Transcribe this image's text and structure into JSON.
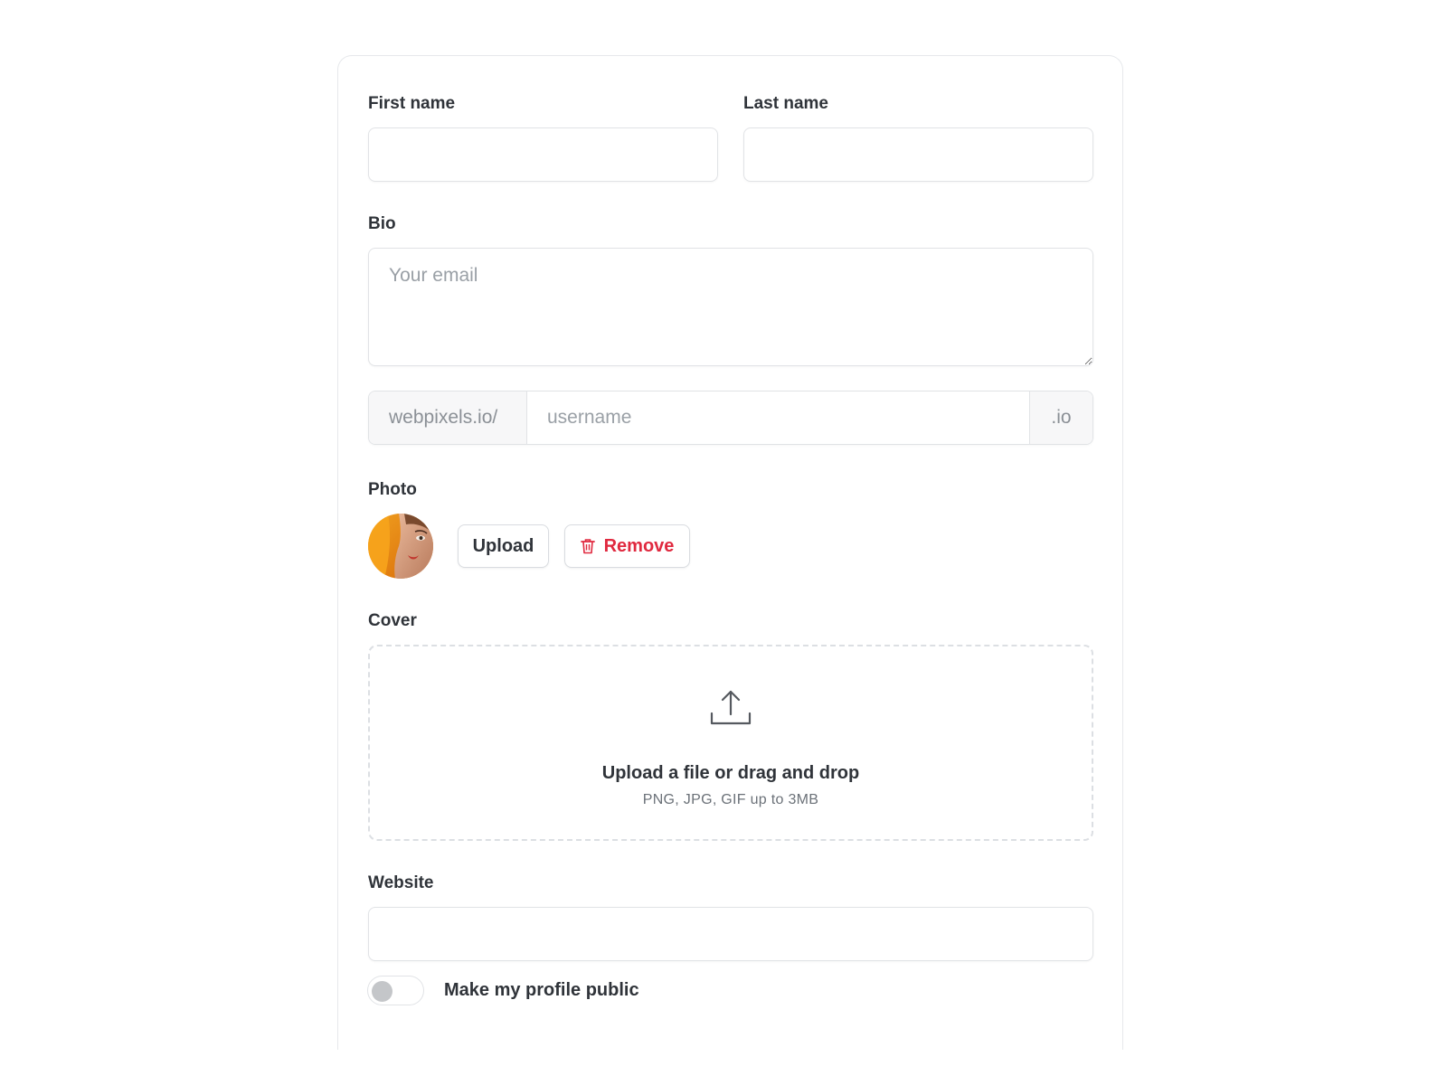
{
  "form": {
    "first_name": {
      "label": "First name",
      "value": "",
      "placeholder": ""
    },
    "last_name": {
      "label": "Last name",
      "value": "",
      "placeholder": ""
    },
    "bio": {
      "label": "Bio",
      "placeholder": "Your email"
    },
    "username": {
      "prefix": "webpixels.io/",
      "placeholder": "username",
      "suffix": ".io"
    },
    "photo": {
      "label": "Photo",
      "upload_label": "Upload",
      "remove_label": "Remove"
    },
    "cover": {
      "label": "Cover",
      "title": "Upload a file or drag and drop",
      "subtitle": "PNG, JPG, GIF up to 3MB"
    },
    "website": {
      "label": "Website",
      "placeholder": ""
    },
    "public_toggle": {
      "label": "Make my profile public",
      "checked": false
    }
  },
  "colors": {
    "danger": "#e0293f",
    "border": "#e1e3e6",
    "addon_bg": "#f7f7f8",
    "toggle_knob": "#c4c6c9"
  },
  "icons": {
    "remove": "trash-icon",
    "cover": "upload-tray-icon"
  }
}
